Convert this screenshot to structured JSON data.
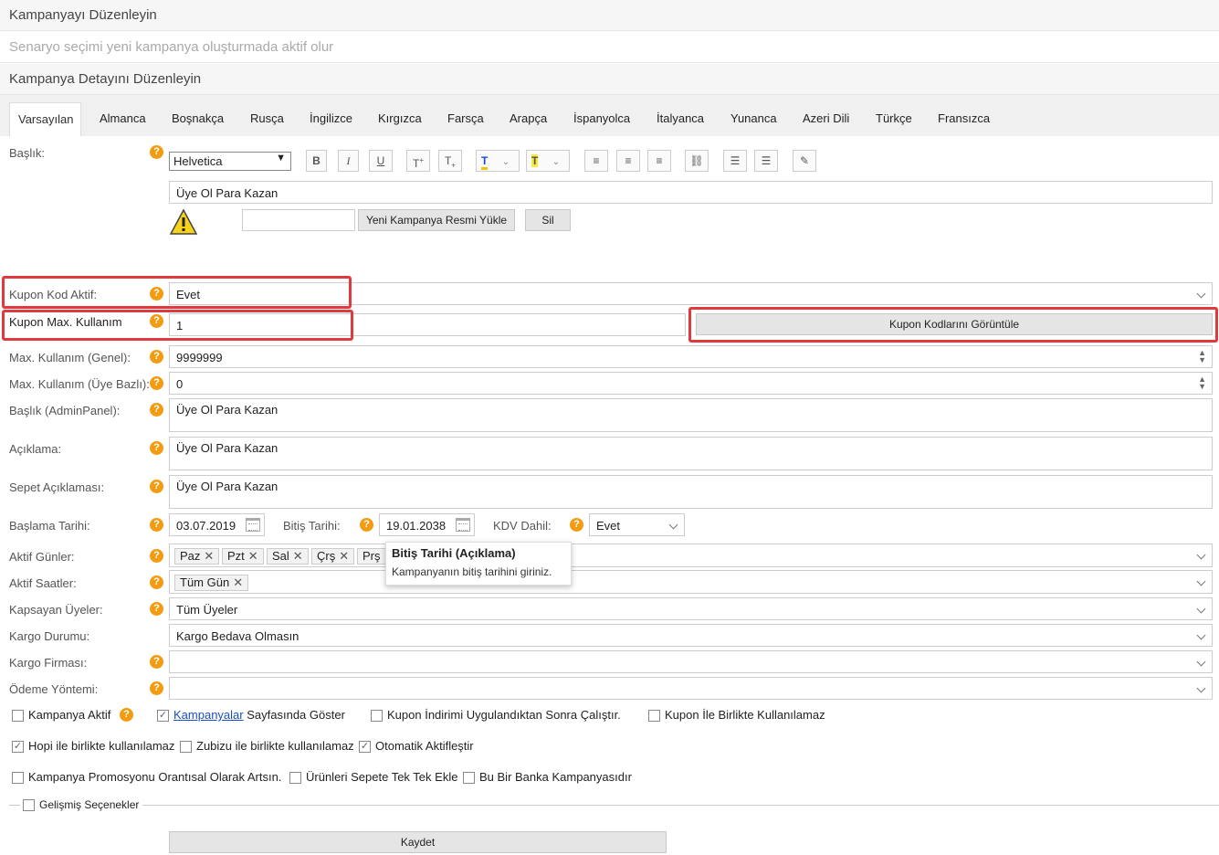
{
  "header": {
    "edit_campaign": "Kampanyayı Düzenleyin",
    "scenario_note": "Senaryo seçimi yeni kampanya oluşturmada aktif olur",
    "edit_detail": "Kampanya Detayını Düzenleyin"
  },
  "tabs": [
    "Varsayılan",
    "Almanca",
    "Boşnakça",
    "Rusça",
    "İngilizce",
    "Kırgızca",
    "Farsça",
    "Arapça",
    "İspanyolca",
    "İtalyanca",
    "Yunanca",
    "Azeri Dili",
    "Türkçe",
    "Fransızca"
  ],
  "editor": {
    "title_label": "Başlık:",
    "font_value": "Helvetica",
    "title_value": "Üye Ol Para Kazan",
    "upload_button": "Yeni Kampanya Resmi Yükle",
    "delete_button": "Sil",
    "toolbar_icons": [
      "bold-icon",
      "italic-icon",
      "underline-icon",
      "superscript-icon",
      "subscript-icon",
      "text-color-icon",
      "highlight-icon",
      "align-left-icon",
      "align-center-icon",
      "align-right-icon",
      "link-icon",
      "ordered-list-icon",
      "unordered-list-icon",
      "clear-format-icon"
    ]
  },
  "form": {
    "coupon_active_label": "Kupon Kod Aktif:",
    "coupon_active_value": "Evet",
    "coupon_max_label": "Kupon Max. Kullanım",
    "coupon_max_value": "1",
    "view_codes_button": "Kupon Kodlarını Görüntüle",
    "max_general_label": "Max. Kullanım (Genel):",
    "max_general_value": "9999999",
    "max_member_label": "Max. Kullanım (Üye Bazlı):",
    "max_member_value": "0",
    "admin_title_label": "Başlık (AdminPanel):",
    "admin_title_value": "Üye Ol Para Kazan",
    "desc_label": "Açıklama:",
    "desc_value": "Üye Ol Para Kazan",
    "cart_desc_label": "Sepet Açıklaması:",
    "cart_desc_value": "Üye Ol Para Kazan",
    "start_label": "Başlama Tarihi:",
    "start_value": "03.07.2019",
    "end_label": "Bitiş Tarihi:",
    "end_value": "19.01.2038",
    "vat_label": "KDV Dahil:",
    "vat_value": "Evet",
    "days_label": "Aktif Günler:",
    "days": [
      "Paz",
      "Pzt",
      "Sal",
      "Çrş",
      "Prş"
    ],
    "hours_label": "Aktif Saatler:",
    "hours": [
      "Tüm Gün"
    ],
    "members_label": "Kapsayan Üyeler:",
    "members_value": "Tüm Üyeler",
    "shipping_label": "Kargo Durumu:",
    "shipping_value": "Kargo Bedava Olmasın",
    "carrier_label": "Kargo Firması:",
    "payment_label": "Ödeme Yöntemi:"
  },
  "tooltip": {
    "title": "Bitiş Tarihi (Açıklama)",
    "body": "Kampanyanın bitiş tarihini giriniz."
  },
  "checkboxes": {
    "campaign_active": "Kampanya Aktif",
    "show_link": "Kampanyalar",
    "show_rest": "Sayfasında Göster",
    "run_after_discount": "Kupon İndirimi Uygulandıktan Sonra Çalıştır.",
    "not_with_coupon": "Kupon İle Birlikte Kullanılamaz",
    "hopi": "Hopi ile birlikte kullanılamaz",
    "zubizu": "Zubizu ile birlikte kullanılamaz",
    "auto_activate": "Otomatik Aktifleştir",
    "proportional": "Kampanya Promosyonu Orantısal Olarak Artsın.",
    "one_by_one": "Ürünleri Sepete Tek Tek Ekle",
    "bank": "Bu Bir Banka Kampanyasıdır",
    "advanced": "Gelişmiş Seçenekler"
  },
  "save_button": "Kaydet",
  "colors": {
    "highlight_red": "#e0393e",
    "help_orange": "#f39c12",
    "link_blue": "#1a4fc4"
  }
}
